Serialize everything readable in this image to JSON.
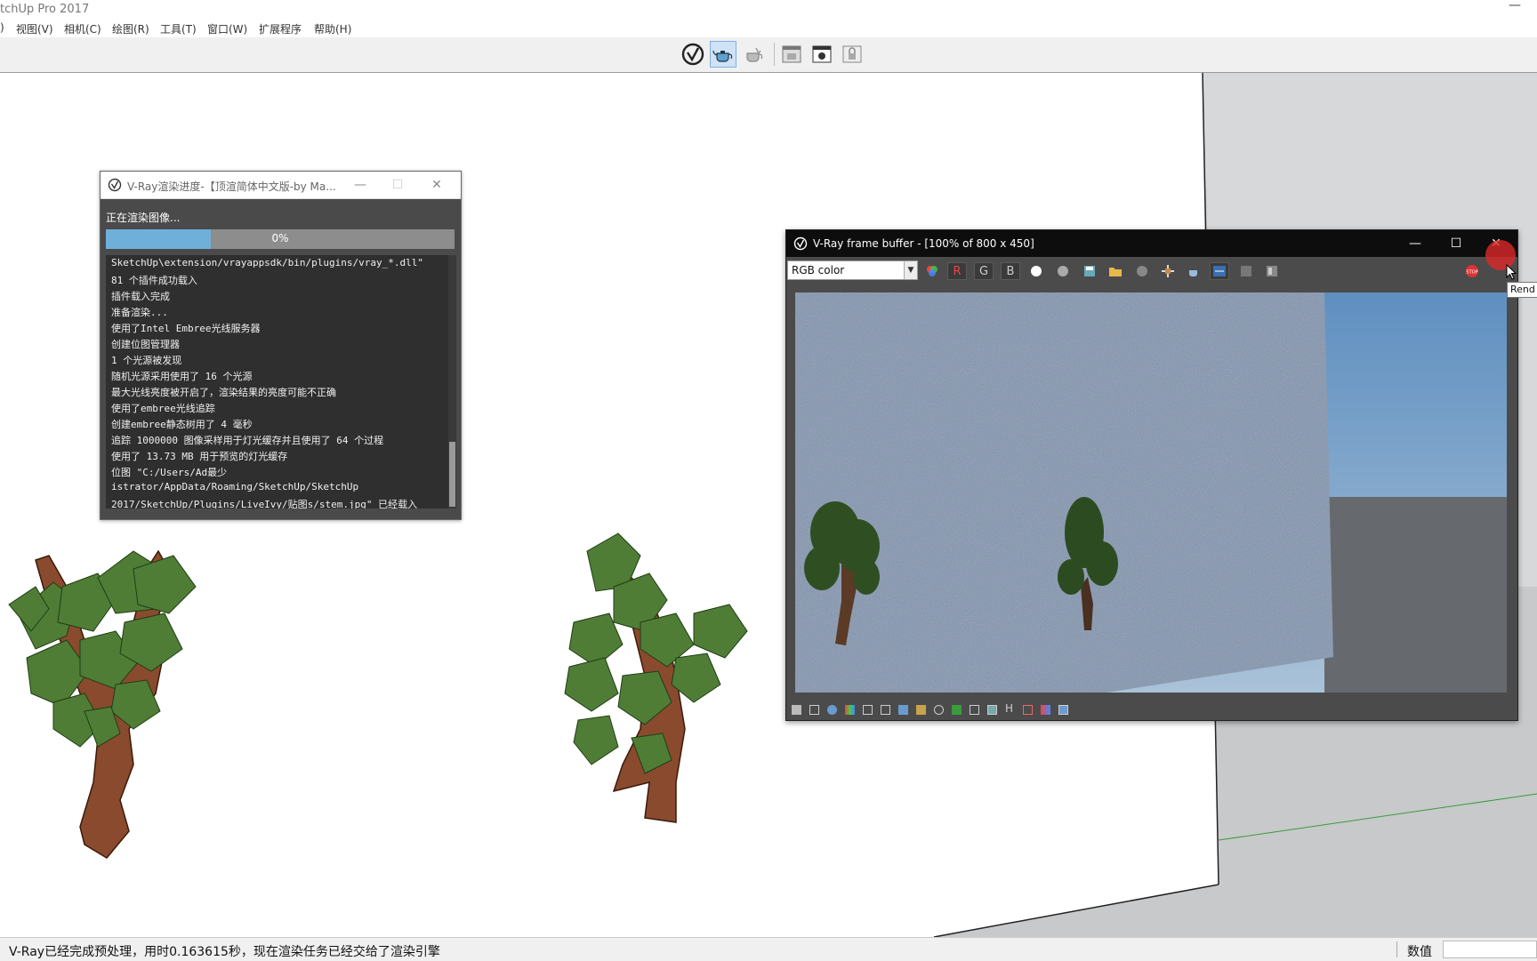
{
  "app": {
    "title": "tchUp Pro 2017",
    "minimize_glyph": "—"
  },
  "menubar": {
    "items": [
      ")",
      "视图(V)",
      "相机(C)",
      "绘图(R)",
      "工具(T)",
      "窗口(W)",
      "扩展程序",
      "帮助(H)"
    ]
  },
  "toolbar": {
    "icons": [
      "vray-logo-icon",
      "render-teapot-icon",
      "interactive-render-icon",
      "frame-buffer-icon",
      "render-region-icon",
      "lock-icon"
    ]
  },
  "progress_window": {
    "title": "V-Ray渲染进度-【顶渲简体中文版-by Ma...",
    "status": "正在渲染图像...",
    "progress_label": "0%",
    "progress": 0.0,
    "log": [
      "SketchUp\\extension/vrayappsdk/bin/plugins/vray_*.dll\"",
      "81 个插件成功载入",
      "插件载入完成",
      "准备渲染...",
      "使用了Intel Embree光线服务器",
      "创建位图管理器",
      "1 个光源被发现",
      "随机光源采用使用了 16 个光源",
      "最大光线亮度被开启了，渲染结果的亮度可能不正确",
      "使用了embree光线追踪",
      "创建embree静态树用了 4 毫秒",
      "追踪 1000000 图像采样用于灯光缓存并且使用了 64 个过程",
      "使用了 13.73 MB 用于预览的灯光缓存",
      "位图 \"C:/Users/Ad最少",
      "istrator/AppData/Roaming/SketchUp/SketchUp",
      "2017/SketchUp/Plugins/LiveIvy/贴图s/stem.jpg\" 已经载入"
    ]
  },
  "frame_buffer": {
    "title": "V-Ray frame buffer - [100% of 800 x 450]",
    "channel": "RGB color",
    "channel_buttons": [
      "R",
      "G",
      "B"
    ],
    "tooltip": "Rend",
    "bottom_h_label": "H"
  },
  "statusbar": {
    "message": "V-Ray已经完成预处理，用时0.163615秒，现在渲染任务已经交给了渲染引擎",
    "value_label": "数值",
    "value": ""
  },
  "colors": {
    "vray_progress": "#6fb0da",
    "foliage": "#4f7d35",
    "trunk": "#8a4a2e",
    "render_wall": "#7a8ba3"
  }
}
